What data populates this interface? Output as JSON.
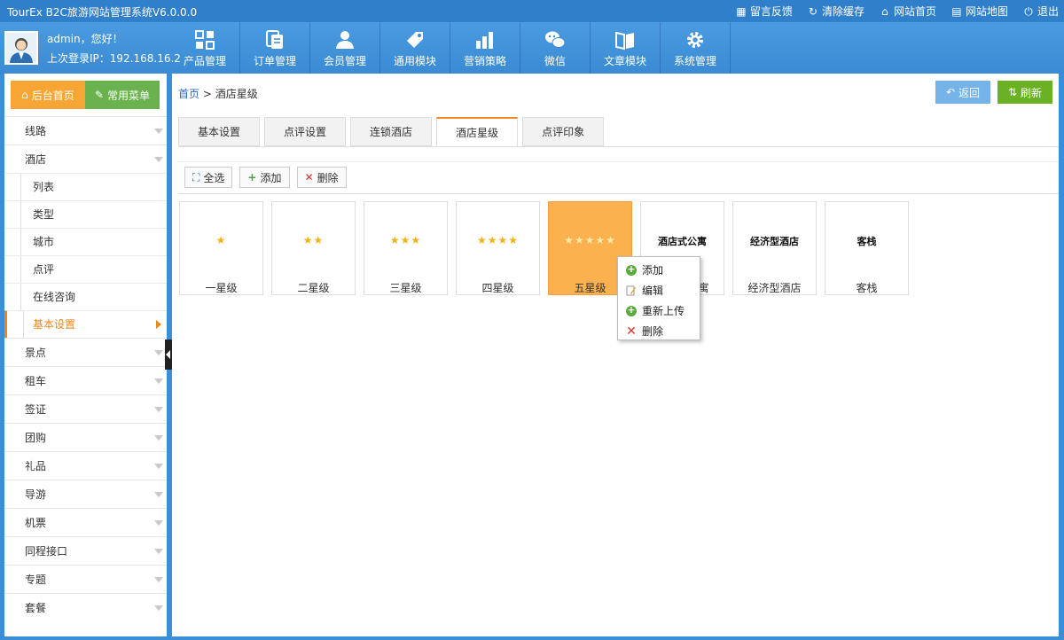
{
  "app": {
    "title": "TourEx B2C旅游网站管理系统V6.0.0.0"
  },
  "toplinks": [
    {
      "label": "留言反馈",
      "icon": "feedback-icon"
    },
    {
      "label": "清除缓存",
      "icon": "refresh-icon"
    },
    {
      "label": "网站首页",
      "icon": "home-icon"
    },
    {
      "label": "网站地图",
      "icon": "map-icon"
    },
    {
      "label": "退出",
      "icon": "power-icon"
    }
  ],
  "user": {
    "greeting": "admin，您好！",
    "last_login": "上次登录IP：192.168.16.2"
  },
  "modules": [
    {
      "label": "产品管理",
      "icon": "grid-icon"
    },
    {
      "label": "订单管理",
      "icon": "document-icon"
    },
    {
      "label": "会员管理",
      "icon": "user-icon"
    },
    {
      "label": "通用模块",
      "icon": "tag-icon"
    },
    {
      "label": "营销策略",
      "icon": "chart-icon"
    },
    {
      "label": "微信",
      "icon": "wechat-icon"
    },
    {
      "label": "文章模块",
      "icon": "book-icon"
    },
    {
      "label": "系统管理",
      "icon": "gear-icon"
    }
  ],
  "sidebar": {
    "home_btn": "后台首页",
    "menu_btn": "常用菜单",
    "items_top": [
      {
        "label": "线路"
      },
      {
        "label": "酒店"
      }
    ],
    "subitems": [
      {
        "label": "列表"
      },
      {
        "label": "类型"
      },
      {
        "label": "城市"
      },
      {
        "label": "点评"
      },
      {
        "label": "在线咨询"
      },
      {
        "label": "基本设置"
      }
    ],
    "items_bottom": [
      {
        "label": "景点"
      },
      {
        "label": "租车"
      },
      {
        "label": "签证"
      },
      {
        "label": "团购"
      },
      {
        "label": "礼品"
      },
      {
        "label": "导游"
      },
      {
        "label": "机票"
      },
      {
        "label": "同程接口"
      },
      {
        "label": "专题"
      },
      {
        "label": "套餐"
      }
    ]
  },
  "breadcrumb": {
    "home": "首页",
    "sep": ">",
    "current": "酒店星级"
  },
  "actions": {
    "back": "返回",
    "refresh": "刷新"
  },
  "tabs": [
    {
      "label": "基本设置"
    },
    {
      "label": "点评设置"
    },
    {
      "label": "连锁酒店"
    },
    {
      "label": "酒店星级"
    },
    {
      "label": "点评印象"
    }
  ],
  "toolbar": {
    "select_all": "全选",
    "add": "添加",
    "delete": "删除"
  },
  "cards": [
    {
      "pic": "★",
      "name": "一星级"
    },
    {
      "pic": "★★",
      "name": "二星级"
    },
    {
      "pic": "★★★",
      "name": "三星级"
    },
    {
      "pic": "★★★★",
      "name": "四星级"
    },
    {
      "pic": "★★★★★",
      "name": "五星级"
    },
    {
      "pic": "酒店式公寓",
      "name": "酒店式公寓"
    },
    {
      "pic": "经济型酒店",
      "name": "经济型酒店"
    },
    {
      "pic": "客栈",
      "name": "客栈"
    }
  ],
  "context_menu": {
    "add": "添加",
    "edit": "编辑",
    "reupload": "重新上传",
    "delete": "删除"
  },
  "colors": {
    "primary": "#2f7fcb",
    "accent_orange": "#f7a535",
    "accent_green": "#6ab24d",
    "highlight_card": "#fbb24e"
  }
}
